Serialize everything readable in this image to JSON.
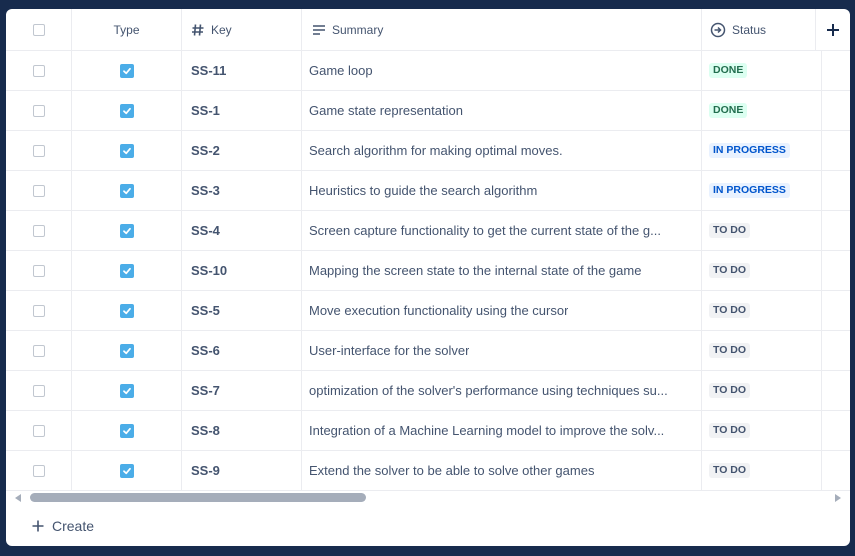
{
  "columns": {
    "type": "Type",
    "key": "Key",
    "summary": "Summary",
    "status": "Status"
  },
  "issues": [
    {
      "key": "SS-11",
      "summary": "Game loop",
      "status": "DONE"
    },
    {
      "key": "SS-1",
      "summary": "Game state representation",
      "status": "DONE"
    },
    {
      "key": "SS-2",
      "summary": "Search algorithm for making optimal moves.",
      "status": "IN PROGRESS"
    },
    {
      "key": "SS-3",
      "summary": "Heuristics to guide the search algorithm",
      "status": "IN PROGRESS"
    },
    {
      "key": "SS-4",
      "summary": "Screen capture functionality to get the current state of the g...",
      "status": "TO DO"
    },
    {
      "key": "SS-10",
      "summary": "Mapping the screen state to the internal state of the game",
      "status": "TO DO"
    },
    {
      "key": "SS-5",
      "summary": "Move execution functionality using the cursor",
      "status": "TO DO"
    },
    {
      "key": "SS-6",
      "summary": "User-interface for the solver",
      "status": "TO DO"
    },
    {
      "key": "SS-7",
      "summary": "optimization of the solver's performance using techniques su...",
      "status": "TO DO"
    },
    {
      "key": "SS-8",
      "summary": "Integration of a Machine Learning model to improve the solv...",
      "status": "TO DO"
    },
    {
      "key": "SS-9",
      "summary": "Extend the solver to be able to solve other games",
      "status": "TO DO"
    }
  ],
  "create_label": "Create",
  "colors": {
    "background": "#172b4d",
    "task_icon": "#4bade8",
    "done_bg": "#dcfff1",
    "done_text": "#216e4e",
    "progress_bg": "#e9f2ff",
    "progress_text": "#0055cc",
    "todo_bg": "#f1f2f4",
    "todo_text": "#44546f"
  },
  "icons": {
    "type": "task-checkbox-icon",
    "key": "hash-icon",
    "summary": "lines-icon",
    "status": "circle-arrow-icon",
    "add_column": "plus-icon",
    "create": "plus-icon"
  }
}
